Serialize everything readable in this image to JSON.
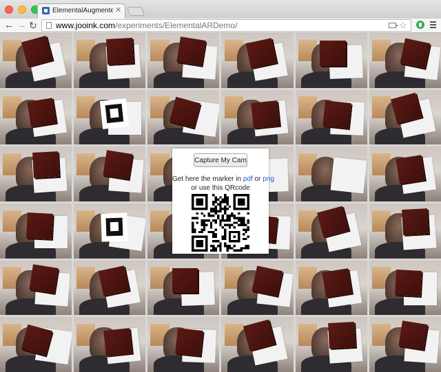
{
  "browser": {
    "tab_title": "ElementalAugmentedReali",
    "url_host": "www.jooink.com",
    "url_path": "/experiments/ElementalARDemo/",
    "icons": {
      "back": "back-arrow-icon",
      "forward": "forward-arrow-icon",
      "reload": "reload-icon",
      "page": "page-icon",
      "camera": "camera-icon",
      "star": "star-icon",
      "extension": "extension-icon",
      "menu": "menu-icon"
    },
    "traffic_colors": {
      "close": "#fc605b",
      "minimize": "#fdbc40",
      "maximize": "#34c84a"
    }
  },
  "panel": {
    "capture_label": "Capture My Cam",
    "marker_prefix": "Get here the marker in",
    "link_pdf": "pdf",
    "or_word": "or",
    "link_png": "png",
    "qr_caption": "or use this QRcode",
    "link_color": "#1a5fd0"
  },
  "frames": {
    "count": 36,
    "columns": 6,
    "rows": 6,
    "cube_color": "#4a1410"
  }
}
